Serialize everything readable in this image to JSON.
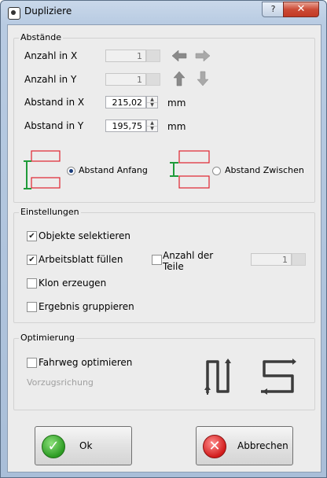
{
  "window": {
    "title": "Dupliziere",
    "help_label": "?",
    "close_label": "✕"
  },
  "abstaende": {
    "legend": "Abstände",
    "anzahl_x": {
      "label": "Anzahl in X",
      "value": "1"
    },
    "anzahl_y": {
      "label": "Anzahl in Y",
      "value": "1"
    },
    "abstand_x": {
      "label": "Abstand in X",
      "value": "215,02",
      "unit": "mm"
    },
    "abstand_y": {
      "label": "Abstand in Y",
      "value": "195,75",
      "unit": "mm"
    },
    "option_anfang": {
      "label": "Abstand Anfang",
      "selected": true
    },
    "option_zwischen": {
      "label": "Abstand Zwischen",
      "selected": false
    }
  },
  "einstellungen": {
    "legend": "Einstellungen",
    "objekte_selektieren": {
      "label": "Objekte selektieren",
      "checked": true
    },
    "arbeitsblatt_fuellen": {
      "label": "Arbeitsblatt füllen",
      "checked": true
    },
    "anzahl_teile": {
      "label_line1": "Anzahl der",
      "label_line2": "Teile",
      "checked": false,
      "value": "1"
    },
    "klon_erzeugen": {
      "label": "Klon erzeugen",
      "checked": false
    },
    "ergebnis_gruppieren": {
      "label": "Ergebnis gruppieren",
      "checked": false
    }
  },
  "optimierung": {
    "legend": "Optimierung",
    "fahrweg_optimieren": {
      "label": "Fahrweg optimieren",
      "checked": false
    },
    "vorzugsrichtung": "Vorzugsrichung"
  },
  "buttons": {
    "ok": "Ok",
    "cancel": "Abbrechen"
  },
  "colors": {
    "diagram_red": "#e0232e",
    "diagram_green": "#1f9b3a",
    "arrow_gray": "#8a8a8a"
  }
}
